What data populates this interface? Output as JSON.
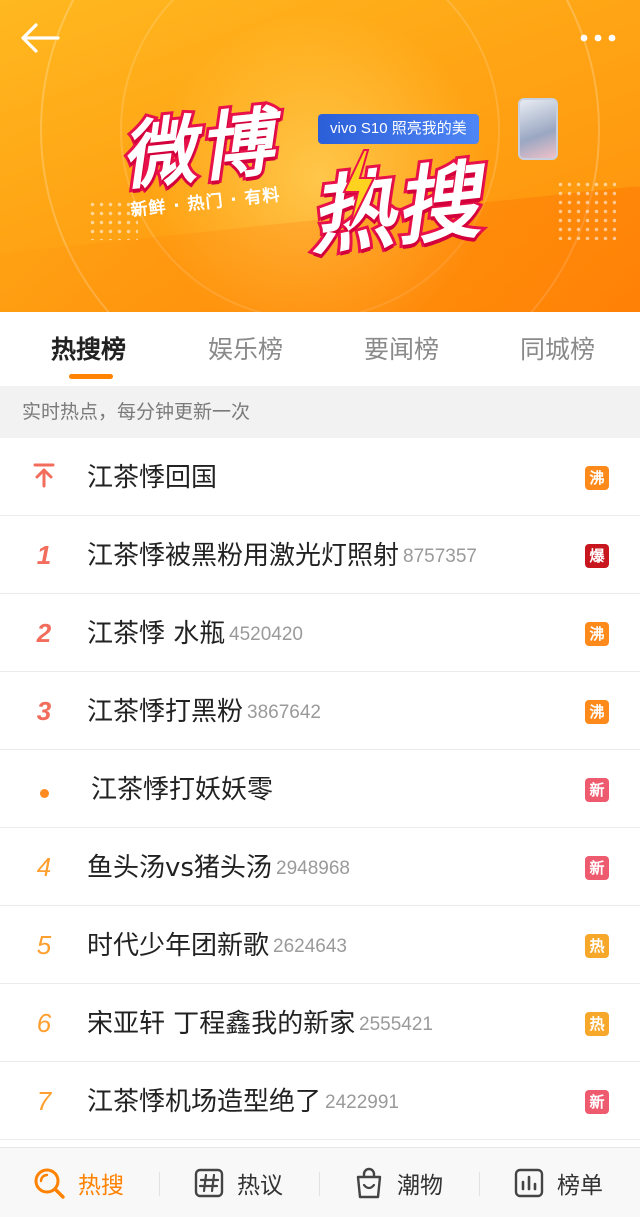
{
  "banner": {
    "logo_weibo": "微博",
    "logo_resou": "热搜",
    "tagline": "新鲜 · 热门 · 有料",
    "ad_brand": "vivo S10",
    "ad_slogan": "照亮我的美"
  },
  "tabs": [
    {
      "label": "热搜榜",
      "active": true
    },
    {
      "label": "娱乐榜",
      "active": false
    },
    {
      "label": "要闻榜",
      "active": false
    },
    {
      "label": "同城榜",
      "active": false
    }
  ],
  "subheader": "实时热点，每分钟更新一次",
  "items": [
    {
      "rank": "pinned",
      "title": "江茶悸回国",
      "heat": "",
      "badge": "沸"
    },
    {
      "rank": "1",
      "title": "江茶悸被黑粉用激光灯照射",
      "heat": "8757357",
      "badge": "爆"
    },
    {
      "rank": "2",
      "title": "江茶悸 水瓶",
      "heat": "4520420",
      "badge": "沸"
    },
    {
      "rank": "3",
      "title": "江茶悸打黑粉",
      "heat": "3867642",
      "badge": "沸"
    },
    {
      "rank": "dot",
      "title": "江茶悸打妖妖零",
      "heat": "",
      "badge": "新"
    },
    {
      "rank": "4",
      "title": "鱼头汤vs猪头汤",
      "heat": "2948968",
      "badge": "新"
    },
    {
      "rank": "5",
      "title": "时代少年团新歌",
      "heat": "2624643",
      "badge": "热"
    },
    {
      "rank": "6",
      "title": "宋亚轩 丁程鑫我的新家",
      "heat": "2555421",
      "badge": "热"
    },
    {
      "rank": "7",
      "title": "江茶悸机场造型绝了",
      "heat": "2422991",
      "badge": "新"
    }
  ],
  "bottom_nav": [
    {
      "label": "热搜",
      "icon": "search-icon",
      "active": true
    },
    {
      "label": "热议",
      "icon": "hashtag-icon",
      "active": false
    },
    {
      "label": "潮物",
      "icon": "shopping-bag-icon",
      "active": false
    },
    {
      "label": "榜单",
      "icon": "bar-chart-icon",
      "active": false
    }
  ],
  "colors": {
    "accent": "#ff8200",
    "rank_top": "#f26d5b",
    "rank_other": "#ff9f2f",
    "badge_fei": "#ff8a1c",
    "badge_bao": "#c8161e",
    "badge_xin": "#ee5a6e",
    "badge_re": "#f7a72a"
  }
}
